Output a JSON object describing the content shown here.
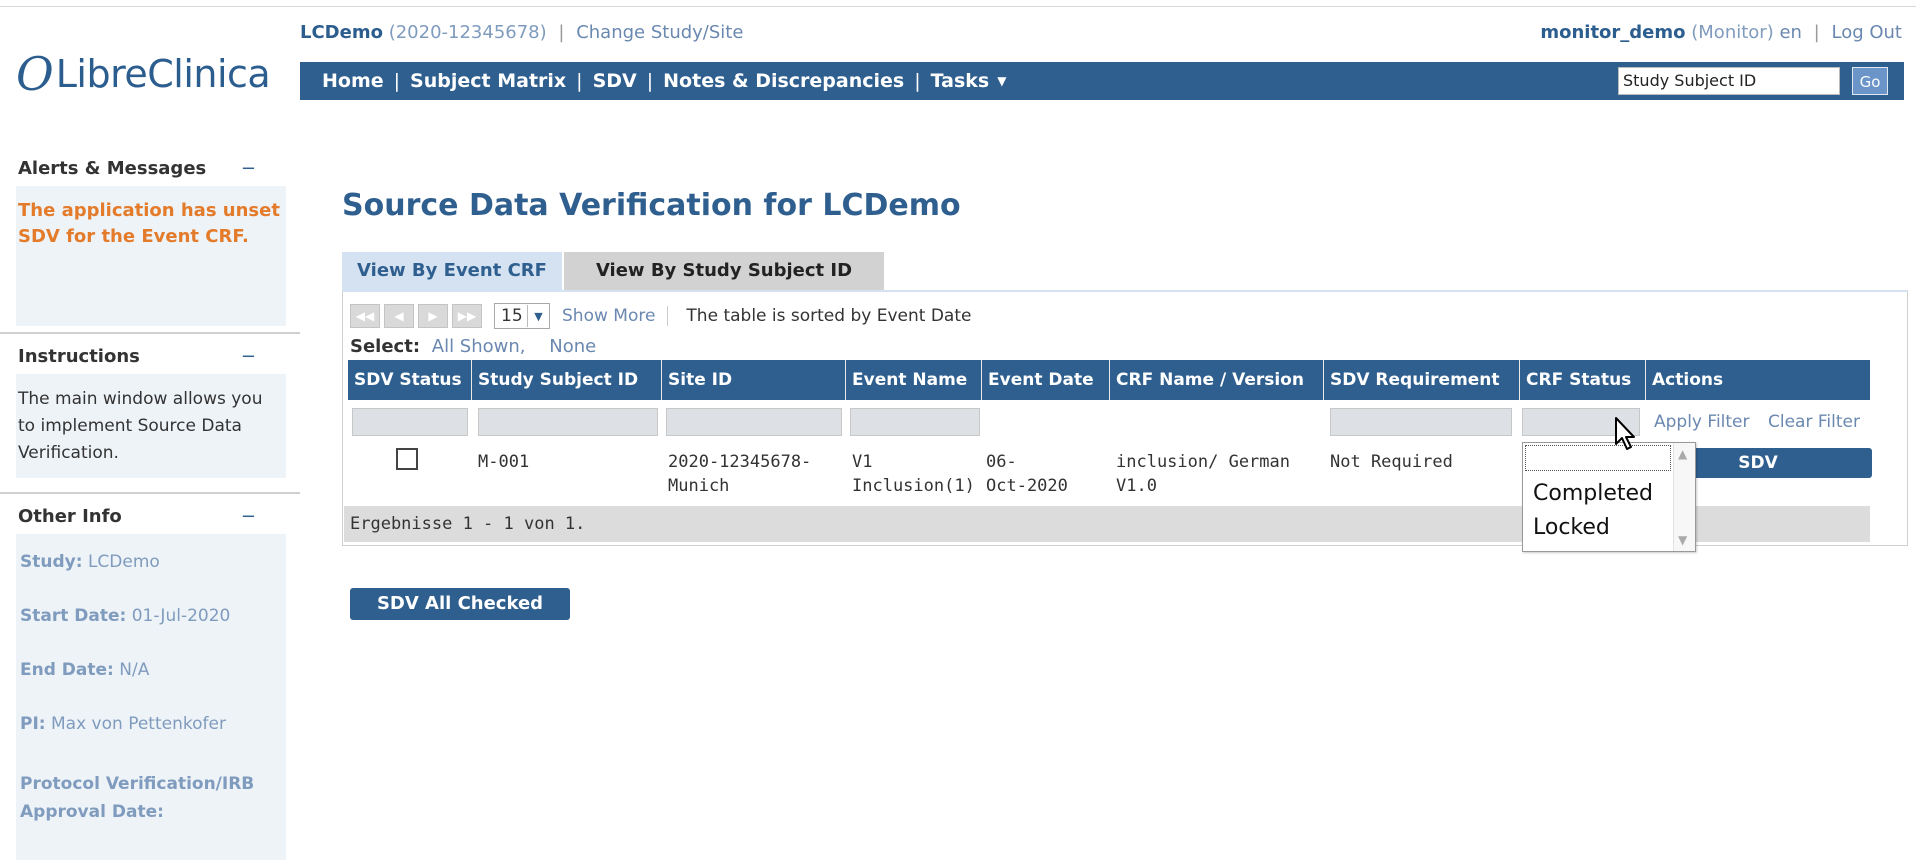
{
  "header": {
    "study_name": "LCDemo",
    "study_id": "(2020-12345678)",
    "change_study_label": "Change Study/Site",
    "user_name": "monitor_demo",
    "user_role": "(Monitor)",
    "language": "en",
    "logout_label": "Log Out",
    "logo_text": "LibreClinica"
  },
  "nav": {
    "items": [
      "Home",
      "Subject Matrix",
      "SDV",
      "Notes & Discrepancies",
      "Tasks"
    ],
    "search_value": "Study Subject ID",
    "go_label": "Go"
  },
  "sidebar": {
    "alerts_title": "Alerts & Messages",
    "alerts_text": "The application has unset SDV for the Event CRF.",
    "instructions_title": "Instructions",
    "instructions_text": "The main window allows you to implement Source Data Verification.",
    "other_info_title": "Other Info",
    "collapse_symbol": "−",
    "study_label": "Study:",
    "study_value": "LCDemo",
    "start_date_label": "Start Date:",
    "start_date_value": "01-Jul-2020",
    "end_date_label": "End Date:",
    "end_date_value": "N/A",
    "pi_label": "PI:",
    "pi_value": "Max von Pettenkofer",
    "irb_label": "Protocol Verification/IRB Approval Date:"
  },
  "main": {
    "title": "Source Data Verification for LCDemo",
    "tabs": [
      "View By Event CRF",
      "View By Study Subject ID"
    ],
    "page_size": "15",
    "show_more": "Show More",
    "sort_note": "The table is sorted by Event Date",
    "select_label": "Select:",
    "select_all": "All Shown,",
    "select_none": "None",
    "columns": [
      "SDV Status",
      "Study Subject ID",
      "Site ID",
      "Event Name",
      "Event Date",
      "CRF Name / Version",
      "SDV Requirement",
      "CRF Status",
      "Actions"
    ],
    "apply_filter": "Apply Filter",
    "clear_filter": "Clear Filter",
    "row": {
      "subject_id": "M-001",
      "site_id_1": "2020-12345678-",
      "site_id_2": "Munich",
      "event_name_1": "V1",
      "event_name_2": "Inclusion(1)",
      "event_date_1": "06-",
      "event_date_2": "Oct-2020",
      "crf_1": "inclusion/ German",
      "crf_2": "V1.0",
      "sdv_requirement": "Not Required",
      "action_label": "SDV"
    },
    "crf_status_options": [
      "",
      "Completed",
      "Locked"
    ],
    "footer": "Ergebnisse 1 - 1 von 1.",
    "sdv_all_label": "SDV All Checked"
  }
}
